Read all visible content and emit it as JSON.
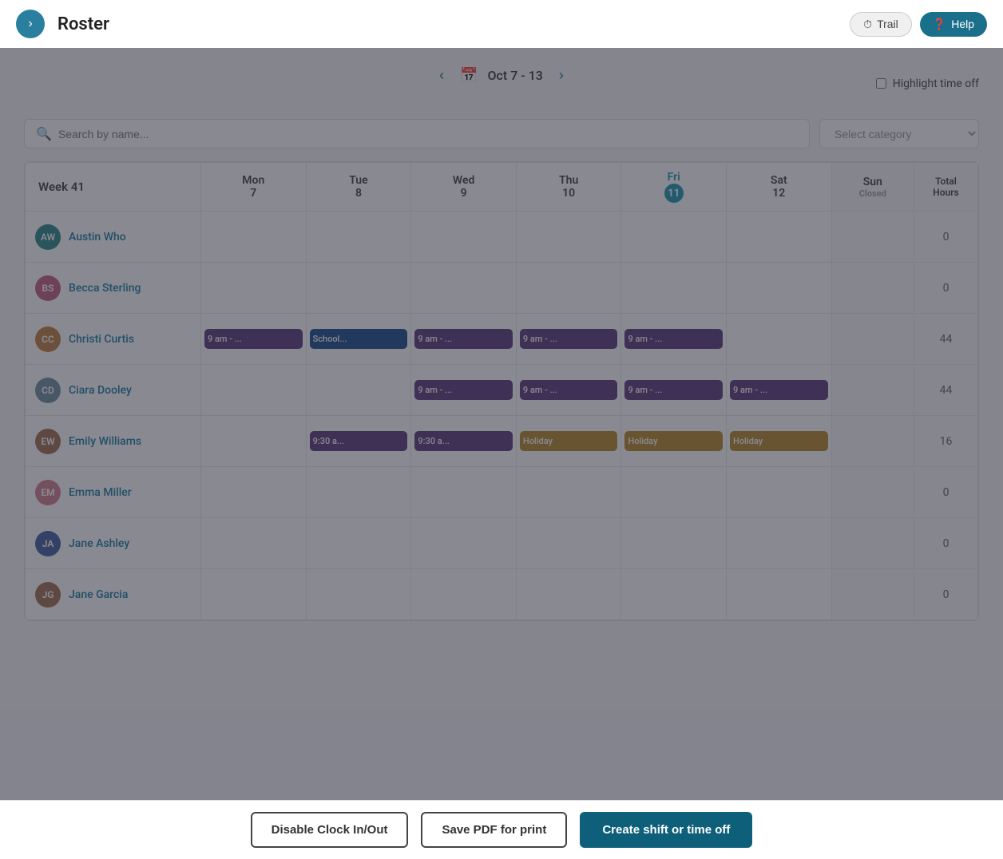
{
  "topbar": {
    "toggle_icon": "›",
    "title": "Roster",
    "trail_label": "Trail",
    "help_label": "Help"
  },
  "date_nav": {
    "prev_icon": "‹",
    "next_icon": "›",
    "calendar_icon": "📅",
    "label": "Oct 7 - 13",
    "highlight_label": "Highlight time off"
  },
  "search": {
    "placeholder": "Search by name...",
    "category_placeholder": "Select category"
  },
  "table": {
    "week_label": "Week 41",
    "columns": [
      {
        "id": "mon",
        "day": "Mon",
        "date": "7"
      },
      {
        "id": "tue",
        "day": "Tue",
        "date": "8"
      },
      {
        "id": "wed",
        "day": "Wed",
        "date": "9"
      },
      {
        "id": "thu",
        "day": "Thu",
        "date": "10"
      },
      {
        "id": "fri",
        "day": "Fri",
        "date": "11",
        "highlight": true
      },
      {
        "id": "sat",
        "day": "Sat",
        "date": "12"
      },
      {
        "id": "sun",
        "day": "Sun",
        "sub": "Closed",
        "closed": true
      }
    ],
    "total_label": "Total\nHours",
    "rows": [
      {
        "name": "Austin Who",
        "avatar_initials": "AW",
        "avatar_color": "av-teal",
        "shifts": {
          "mon": "",
          "tue": "",
          "wed": "",
          "thu": "",
          "fri": "",
          "sat": "",
          "sun": ""
        },
        "total": "0"
      },
      {
        "name": "Becca Sterling",
        "avatar_initials": "BS",
        "avatar_color": "av-pink",
        "shifts": {
          "mon": "",
          "tue": "",
          "wed": "",
          "thu": "",
          "fri": "",
          "sat": "",
          "sun": ""
        },
        "total": "0"
      },
      {
        "name": "Christi Curtis",
        "avatar_initials": "CC",
        "avatar_color": "av-orange",
        "shifts": {
          "mon": "9 am - ...",
          "tue": "School...",
          "wed": "9 am - ...",
          "thu": "9 am - ...",
          "fri": "9 am - ...",
          "sat": "",
          "sun": ""
        },
        "shift_types": {
          "mon": "purple",
          "tue": "blue",
          "wed": "purple",
          "thu": "purple",
          "fri": "purple"
        },
        "total": "44"
      },
      {
        "name": "Ciara Dooley",
        "avatar_initials": "CD",
        "avatar_color": "av-gray",
        "shifts": {
          "mon": "",
          "tue": "",
          "wed": "9 am - ...",
          "thu": "9 am - ...",
          "fri": "9 am - ...",
          "sat": "9 am - ...",
          "sun": ""
        },
        "shift_types": {
          "wed": "purple",
          "thu": "purple",
          "fri": "purple",
          "sat": "purple"
        },
        "total": "44"
      },
      {
        "name": "Emily Williams",
        "avatar_initials": "EW",
        "avatar_color": "av-brown",
        "shifts": {
          "mon": "",
          "tue": "9:30 a...",
          "wed": "9:30 a...",
          "thu": "Holiday",
          "fri": "Holiday",
          "sat": "Holiday",
          "sun": ""
        },
        "shift_types": {
          "tue": "purple",
          "wed": "purple",
          "thu": "gold",
          "fri": "gold",
          "sat": "gold"
        },
        "total": "16"
      },
      {
        "name": "Emma Miller",
        "avatar_initials": "EM",
        "avatar_color": "av-lightpink",
        "shifts": {
          "mon": "",
          "tue": "",
          "wed": "",
          "thu": "",
          "fri": "",
          "sat": "",
          "sun": ""
        },
        "total": "0"
      },
      {
        "name": "Jane Ashley",
        "avatar_initials": "JA",
        "avatar_color": "av-blue",
        "shifts": {
          "mon": "",
          "tue": "",
          "wed": "",
          "thu": "",
          "fri": "",
          "sat": "",
          "sun": ""
        },
        "total": "0"
      },
      {
        "name": "Jane Garcia",
        "avatar_initials": "JG",
        "avatar_color": "av-brown",
        "shifts": {
          "mon": "",
          "tue": "",
          "wed": "",
          "thu": "",
          "fri": "",
          "sat": "",
          "sun": ""
        },
        "total": "0"
      }
    ]
  },
  "bottom_bar": {
    "disable_clock_label": "Disable Clock In/Out",
    "save_pdf_label": "Save PDF for print",
    "create_shift_label": "Create shift or time off"
  }
}
